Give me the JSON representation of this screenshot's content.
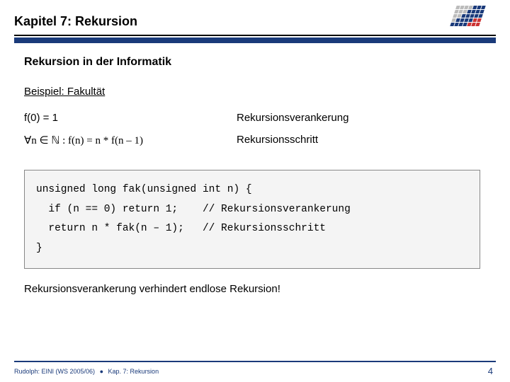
{
  "header": {
    "title": "Kapitel 7: Rekursion"
  },
  "content": {
    "heading": "Rekursion in der Informatik",
    "subheading": "Beispiel: Fakultät",
    "defs": [
      {
        "left": "f(0) = 1",
        "right": "Rekursionsverankerung"
      },
      {
        "left": "∀n ∈ ℕ : f(n) = n * f(n – 1)",
        "right": "Rekursionsschritt"
      }
    ],
    "code": {
      "l1": "unsigned long fak(unsigned int n) {",
      "l2": "  if (n == 0) return 1;    // Rekursionsverankerung",
      "l3": "  return n * fak(n – 1);   // Rekursionsschritt",
      "l4": "}"
    },
    "note": "Rekursionsverankerung verhindert endlose Rekursion!"
  },
  "footer": {
    "left1": "Rudolph: EINI (WS 2005/06)",
    "left2": "Kap. 7: Rekursion",
    "page": "4"
  }
}
